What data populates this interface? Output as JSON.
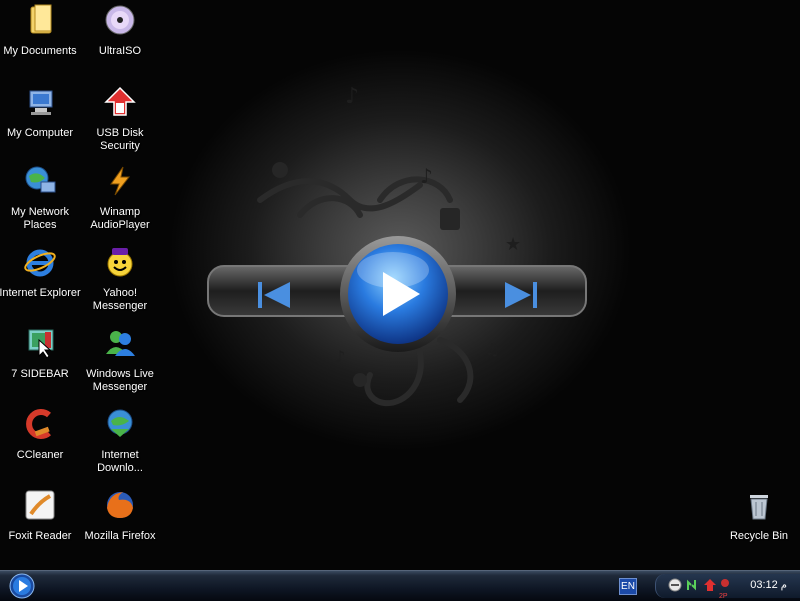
{
  "desktop": {
    "icons_left": [
      {
        "label": "My Documents"
      },
      {
        "label": "My Computer"
      },
      {
        "label": "My Network Places"
      },
      {
        "label": "Internet Explorer"
      },
      {
        "label": "7 SIDEBAR"
      },
      {
        "label": "CCleaner"
      },
      {
        "label": "Foxit Reader"
      }
    ],
    "icons_right": [
      {
        "label": "UltraISO"
      },
      {
        "label": "USB Disk Security"
      },
      {
        "label": "Winamp AudioPlayer"
      },
      {
        "label": "Yahoo! Messenger"
      },
      {
        "label": "Windows Live Messenger"
      },
      {
        "label": "Internet Downlo..."
      },
      {
        "label": "Mozilla Firefox"
      }
    ],
    "recycle_bin": {
      "label": "Recycle Bin"
    }
  },
  "taskbar": {
    "language": "EN",
    "clock": "03:12",
    "ampm": "م",
    "tray_badge": "2P"
  },
  "colors": {
    "accent": "#2a7be0",
    "taskbar": "#0e1624"
  }
}
